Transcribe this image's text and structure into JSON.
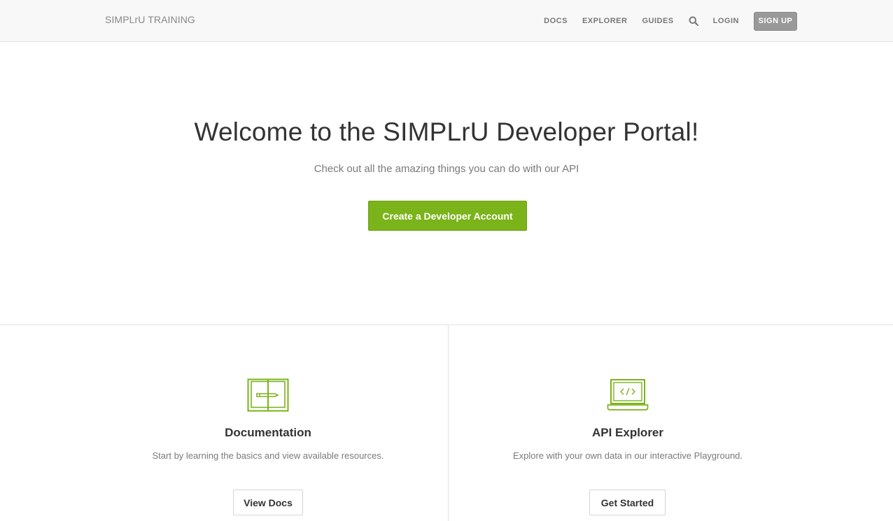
{
  "header": {
    "brand": "SIMPLrU TRAINING",
    "nav": {
      "docs": "DOCS",
      "explorer": "EXPLORER",
      "guides": "GUIDES",
      "login": "LOGIN",
      "signup": "SIGN UP"
    },
    "search_icon": "search-icon"
  },
  "hero": {
    "title": "Welcome to the SIMPLrU Developer Portal!",
    "subtitle": "Check out all the amazing things you can do with our API",
    "cta_label": "Create a Developer Account"
  },
  "features": [
    {
      "icon": "book-icon",
      "title": "Documentation",
      "description": "Start by learning the basics and view available resources.",
      "button": "View Docs"
    },
    {
      "icon": "laptop-code-icon",
      "title": "API Explorer",
      "description": "Explore with your own data in our interactive Playground.",
      "button": "Get Started"
    }
  ],
  "colors": {
    "accent": "#7bb31a",
    "header_bg": "#f8f8f8",
    "signup_bg": "#999999"
  }
}
